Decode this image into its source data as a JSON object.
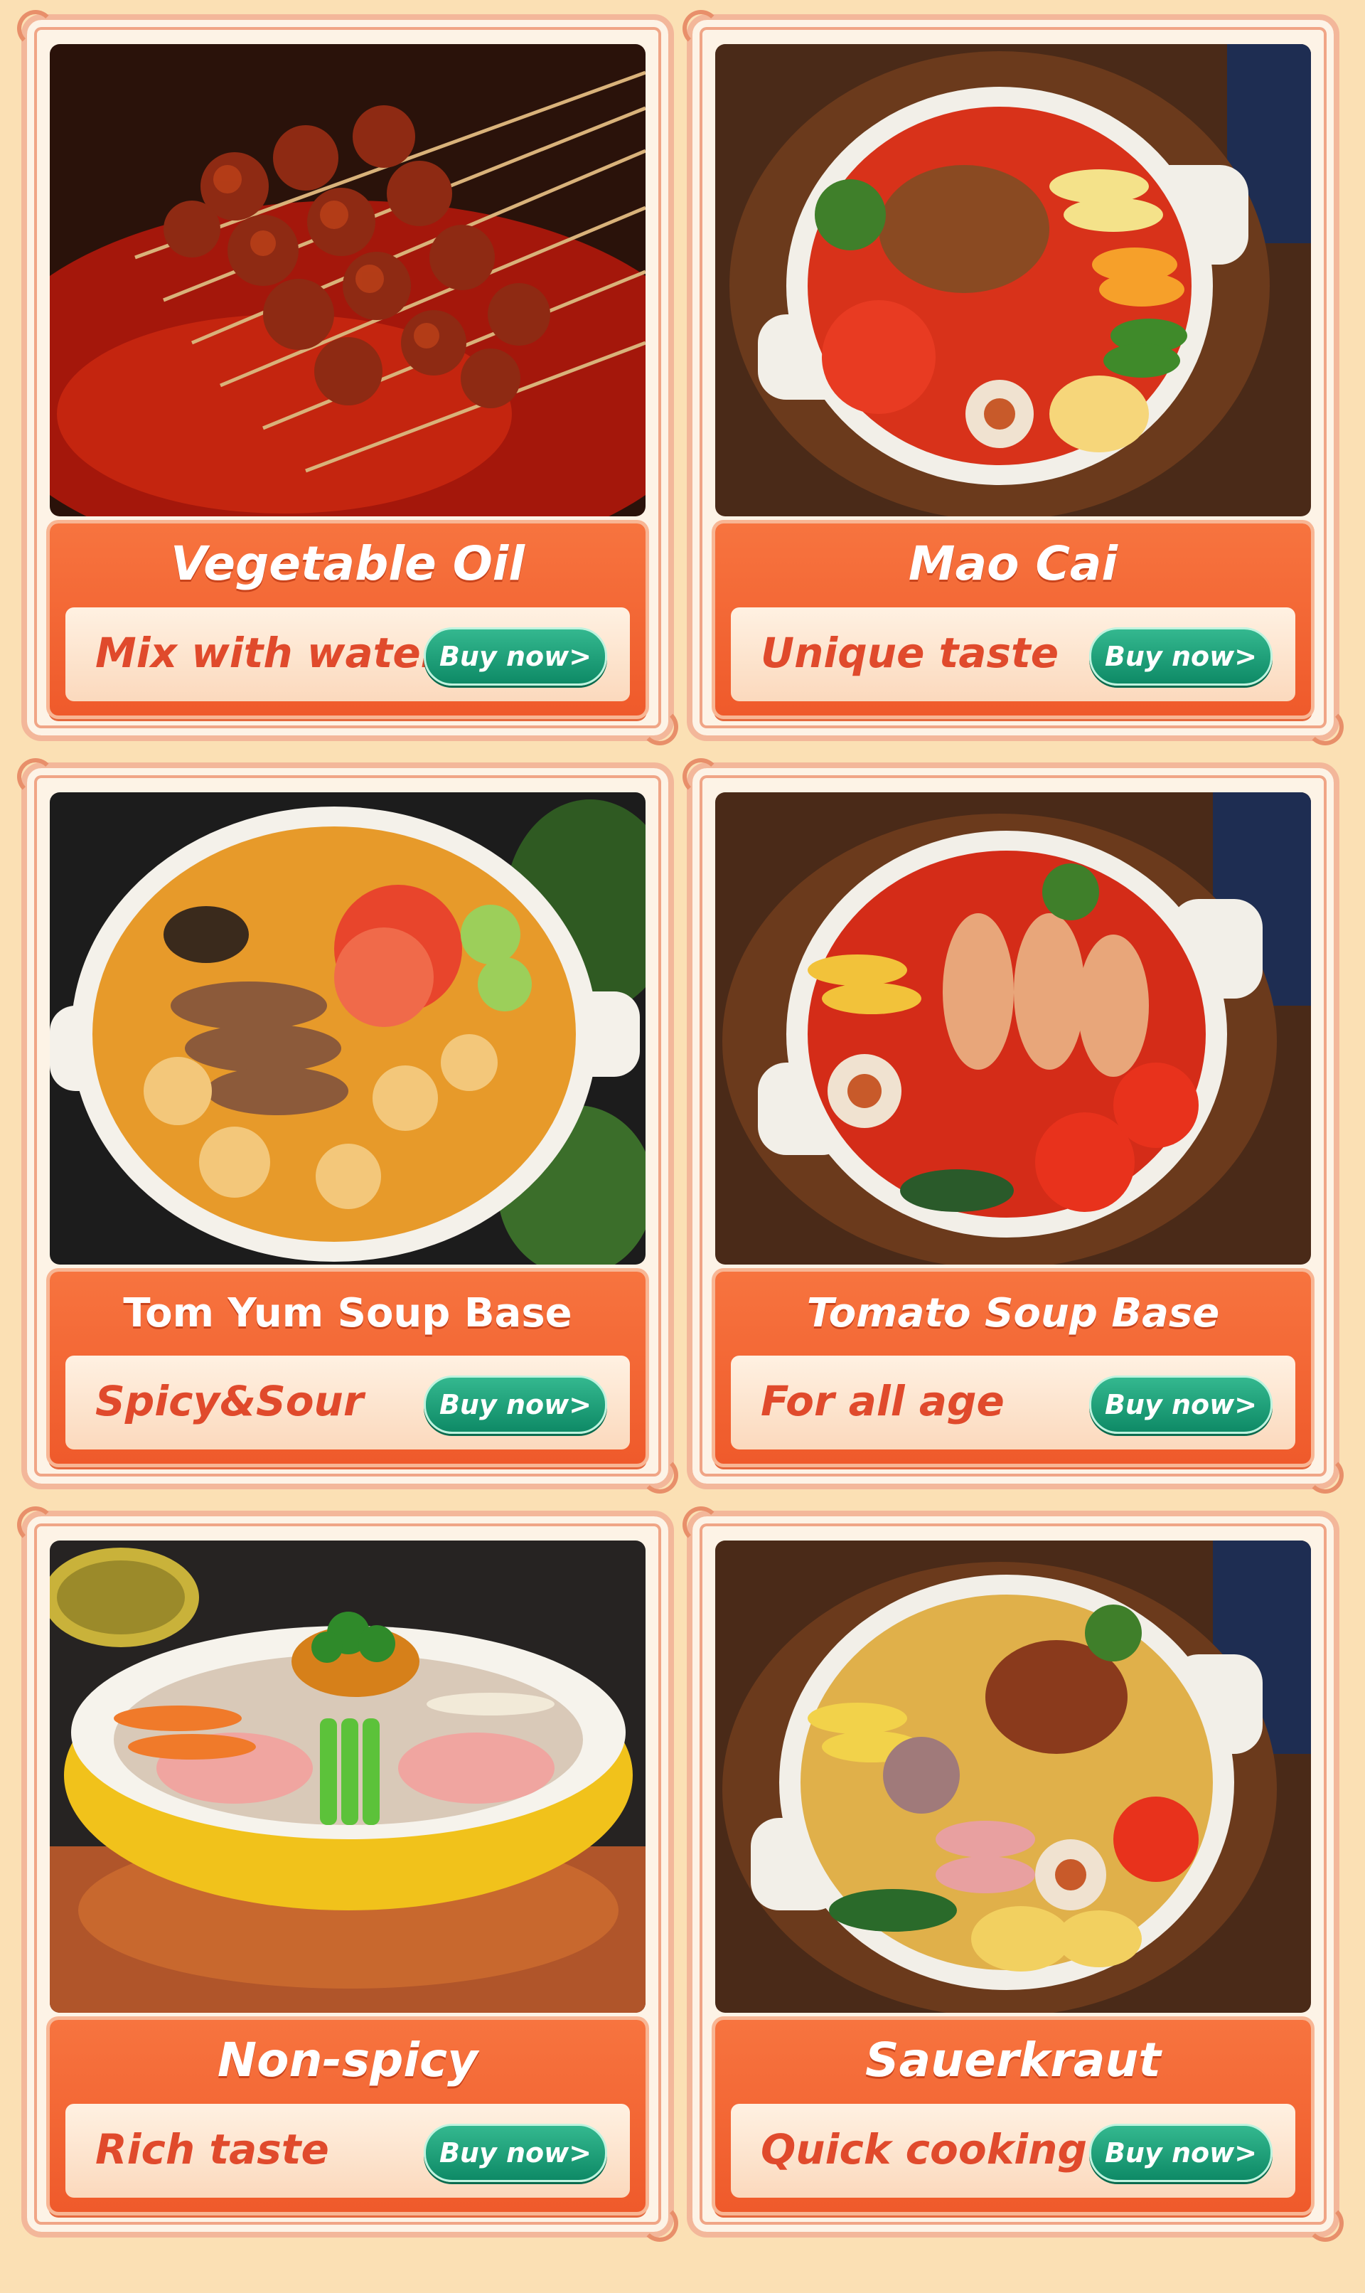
{
  "products": [
    {
      "title": "Vegetable Oil",
      "tagline": "Mix with water",
      "button": "Buy now>",
      "image": "skewers-in-red-chili-broth"
    },
    {
      "title": "Mao Cai",
      "tagline": "Unique taste",
      "button": "Buy now>",
      "image": "mao-cai-pot-with-beef-and-vegetables"
    },
    {
      "title": "Tom Yum Soup Base",
      "tagline": "Spicy&Sour",
      "button": "Buy now>",
      "image": "tom-yum-pot-with-fish-balls"
    },
    {
      "title": "Tomato Soup Base",
      "tagline": "For all age",
      "button": "Buy now>",
      "image": "tomato-soup-pot-with-meat-rolls"
    },
    {
      "title": "Non-spicy",
      "tagline": "Rich taste",
      "button": "Buy now>",
      "image": "yellow-bowl-with-sliced-meats"
    },
    {
      "title": "Sauerkraut",
      "tagline": "Quick cooking",
      "button": "Buy now>",
      "image": "sauerkraut-pot-with-mixed-ingredients"
    }
  ],
  "colors": {
    "page_bg": "#fbe0b4",
    "banner": "#ef5a2b",
    "tagline": "#e04a2c",
    "button": "#0e8a66"
  }
}
